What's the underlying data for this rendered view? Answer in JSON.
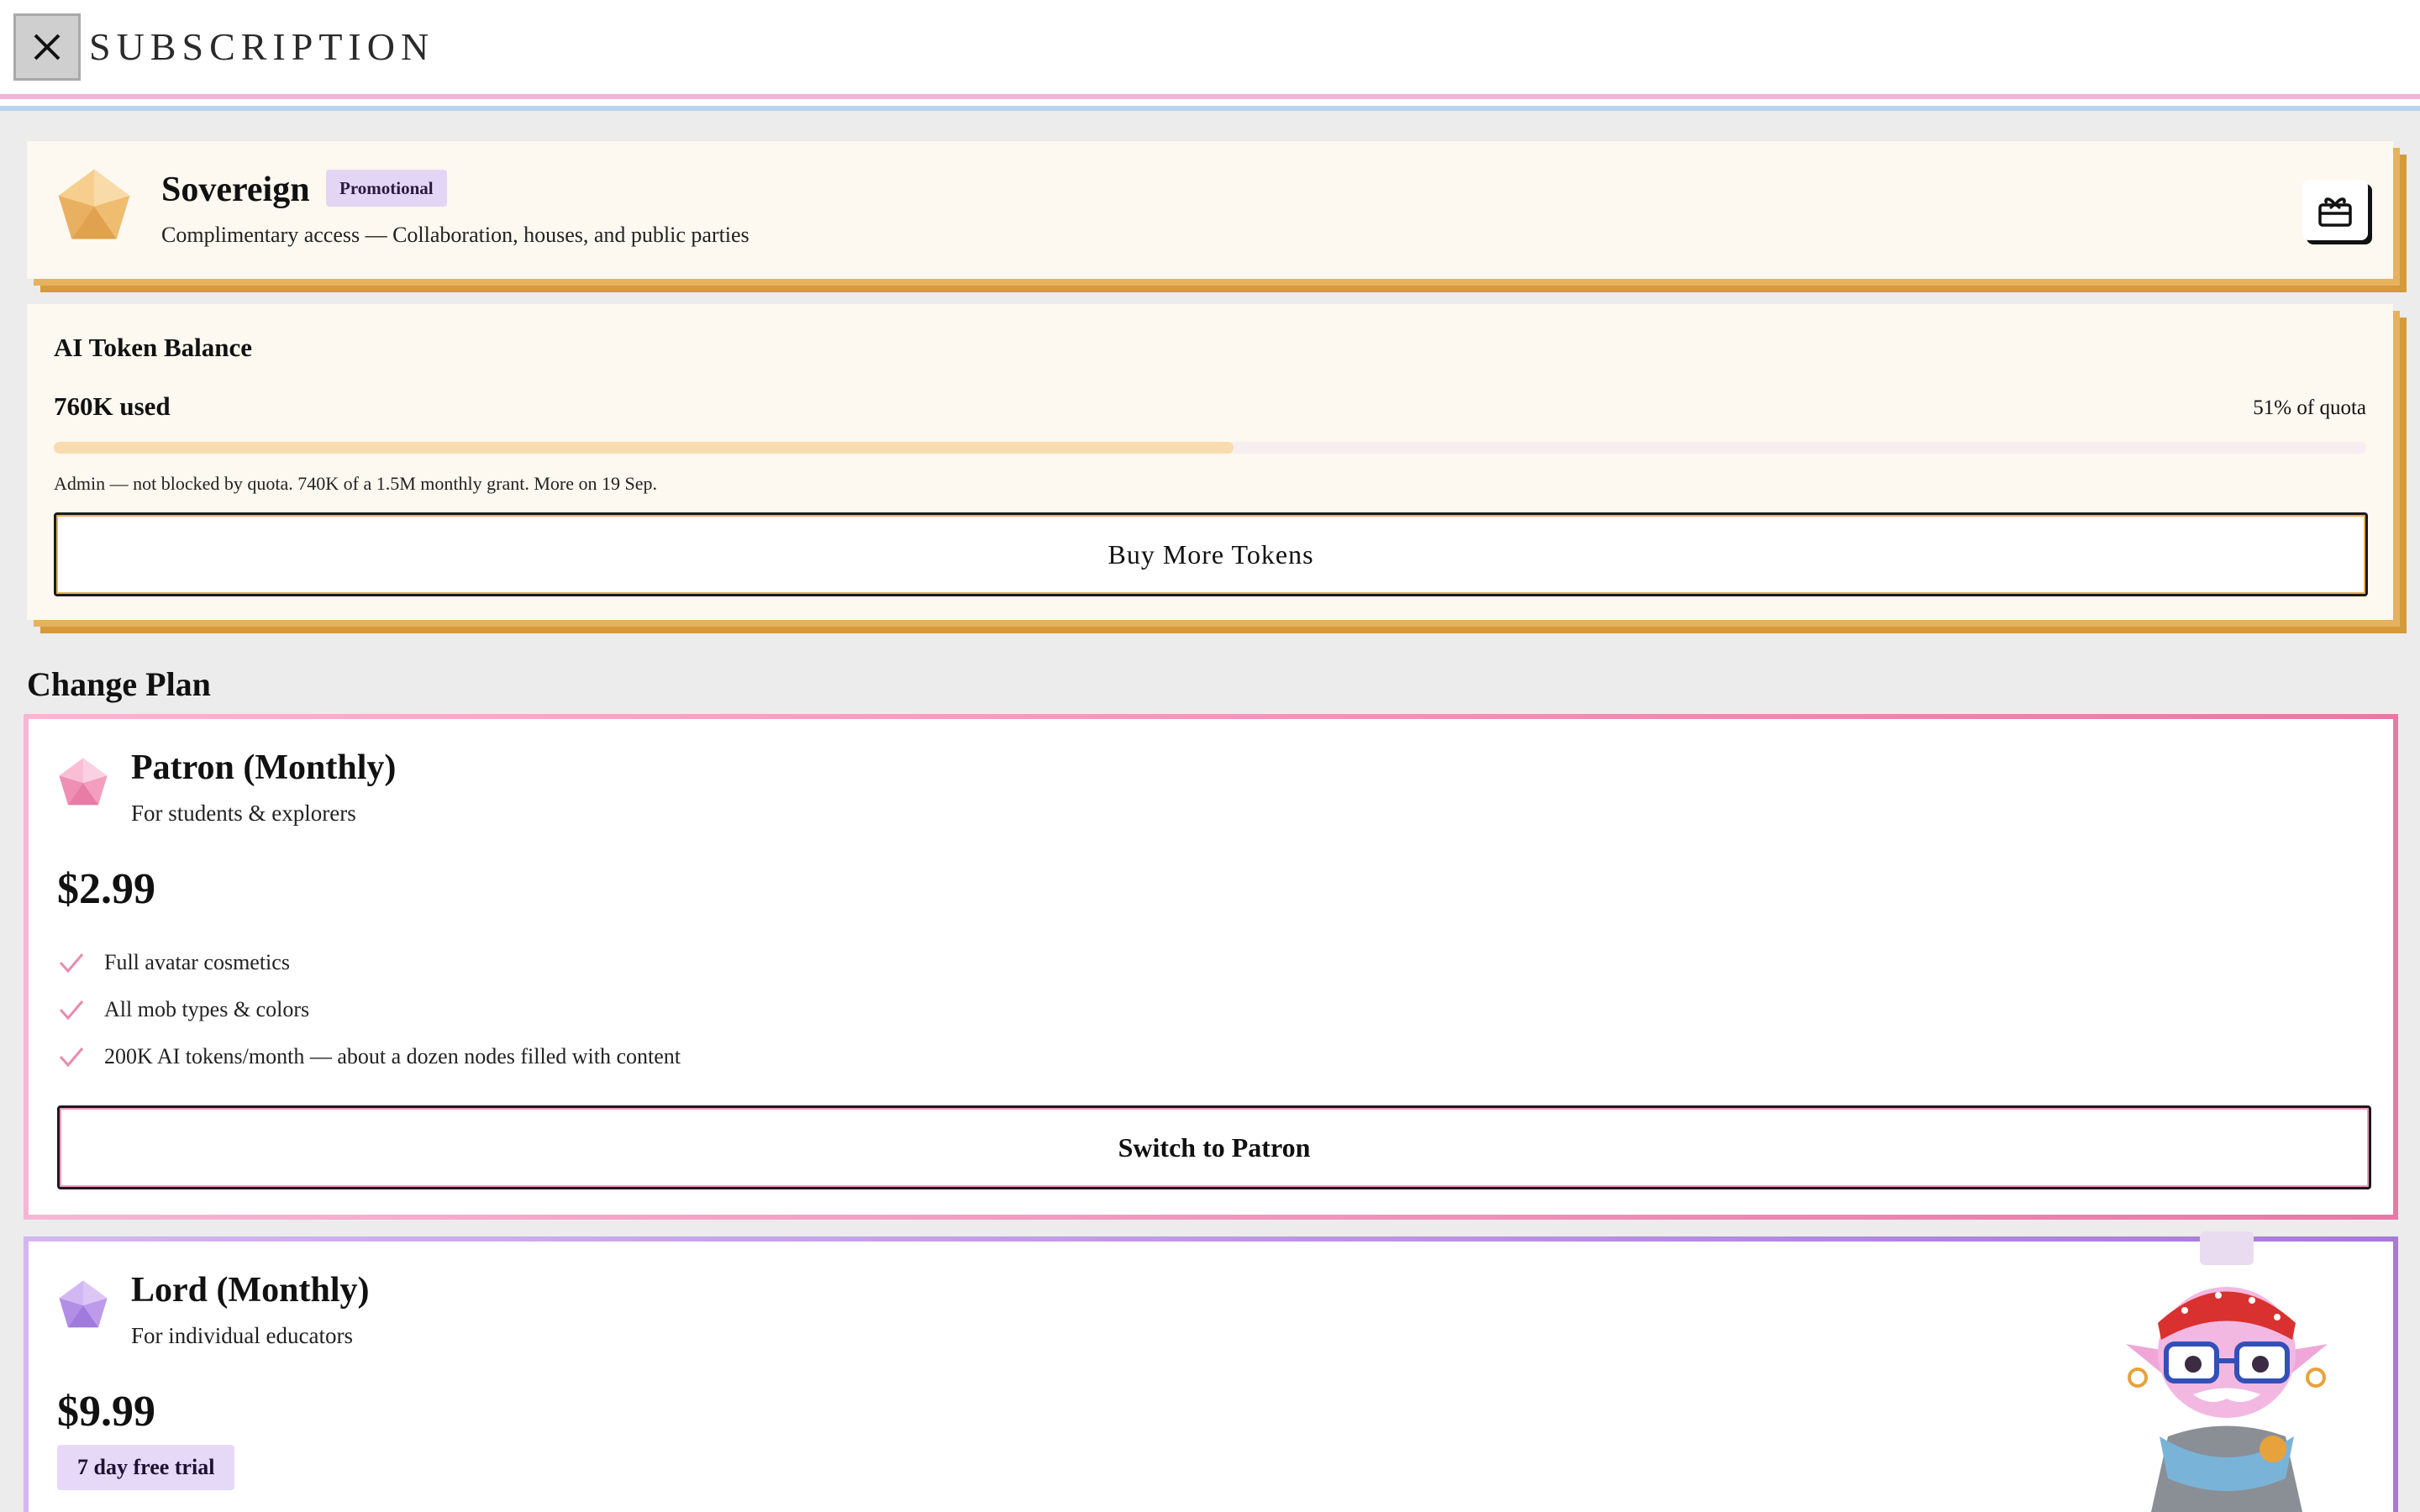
{
  "header": {
    "title": "SUBSCRIPTION",
    "close_icon": "close-icon"
  },
  "current_tier": {
    "icon": "pentagon-gem-icon",
    "name": "Sovereign",
    "badge": "Promotional",
    "description": "Complimentary access — Collaboration, houses, and public parties",
    "action_icon": "gift-icon"
  },
  "tokens": {
    "title": "AI Token Balance",
    "used": "760K used",
    "percent_label": "51% of quota",
    "percent_value": 51,
    "note": "Admin — not blocked by quota. 740K of a 1.5M monthly grant. More on 19 Sep.",
    "buy_label": "Buy More Tokens"
  },
  "change_plan": {
    "heading": "Change Plan",
    "plans": [
      {
        "name": "Patron (Monthly)",
        "subtitle": "For students & explorers",
        "price": "$2.99",
        "icon": "pink-gem-icon",
        "features": [
          "Full avatar cosmetics",
          "All mob types & colors",
          "200K AI tokens/month — about a dozen nodes filled with content"
        ],
        "button_label": "Switch to Patron"
      },
      {
        "name": "Lord (Monthly)",
        "subtitle": "For individual educators",
        "price": "$9.99",
        "icon": "purple-gem-icon",
        "trial_badge": "7 day free trial"
      }
    ]
  },
  "colors": {
    "gold": "#d49a3c",
    "pink": "#e57aa6",
    "purple": "#a87ad8",
    "badge_bg": "#e3d6f5"
  }
}
